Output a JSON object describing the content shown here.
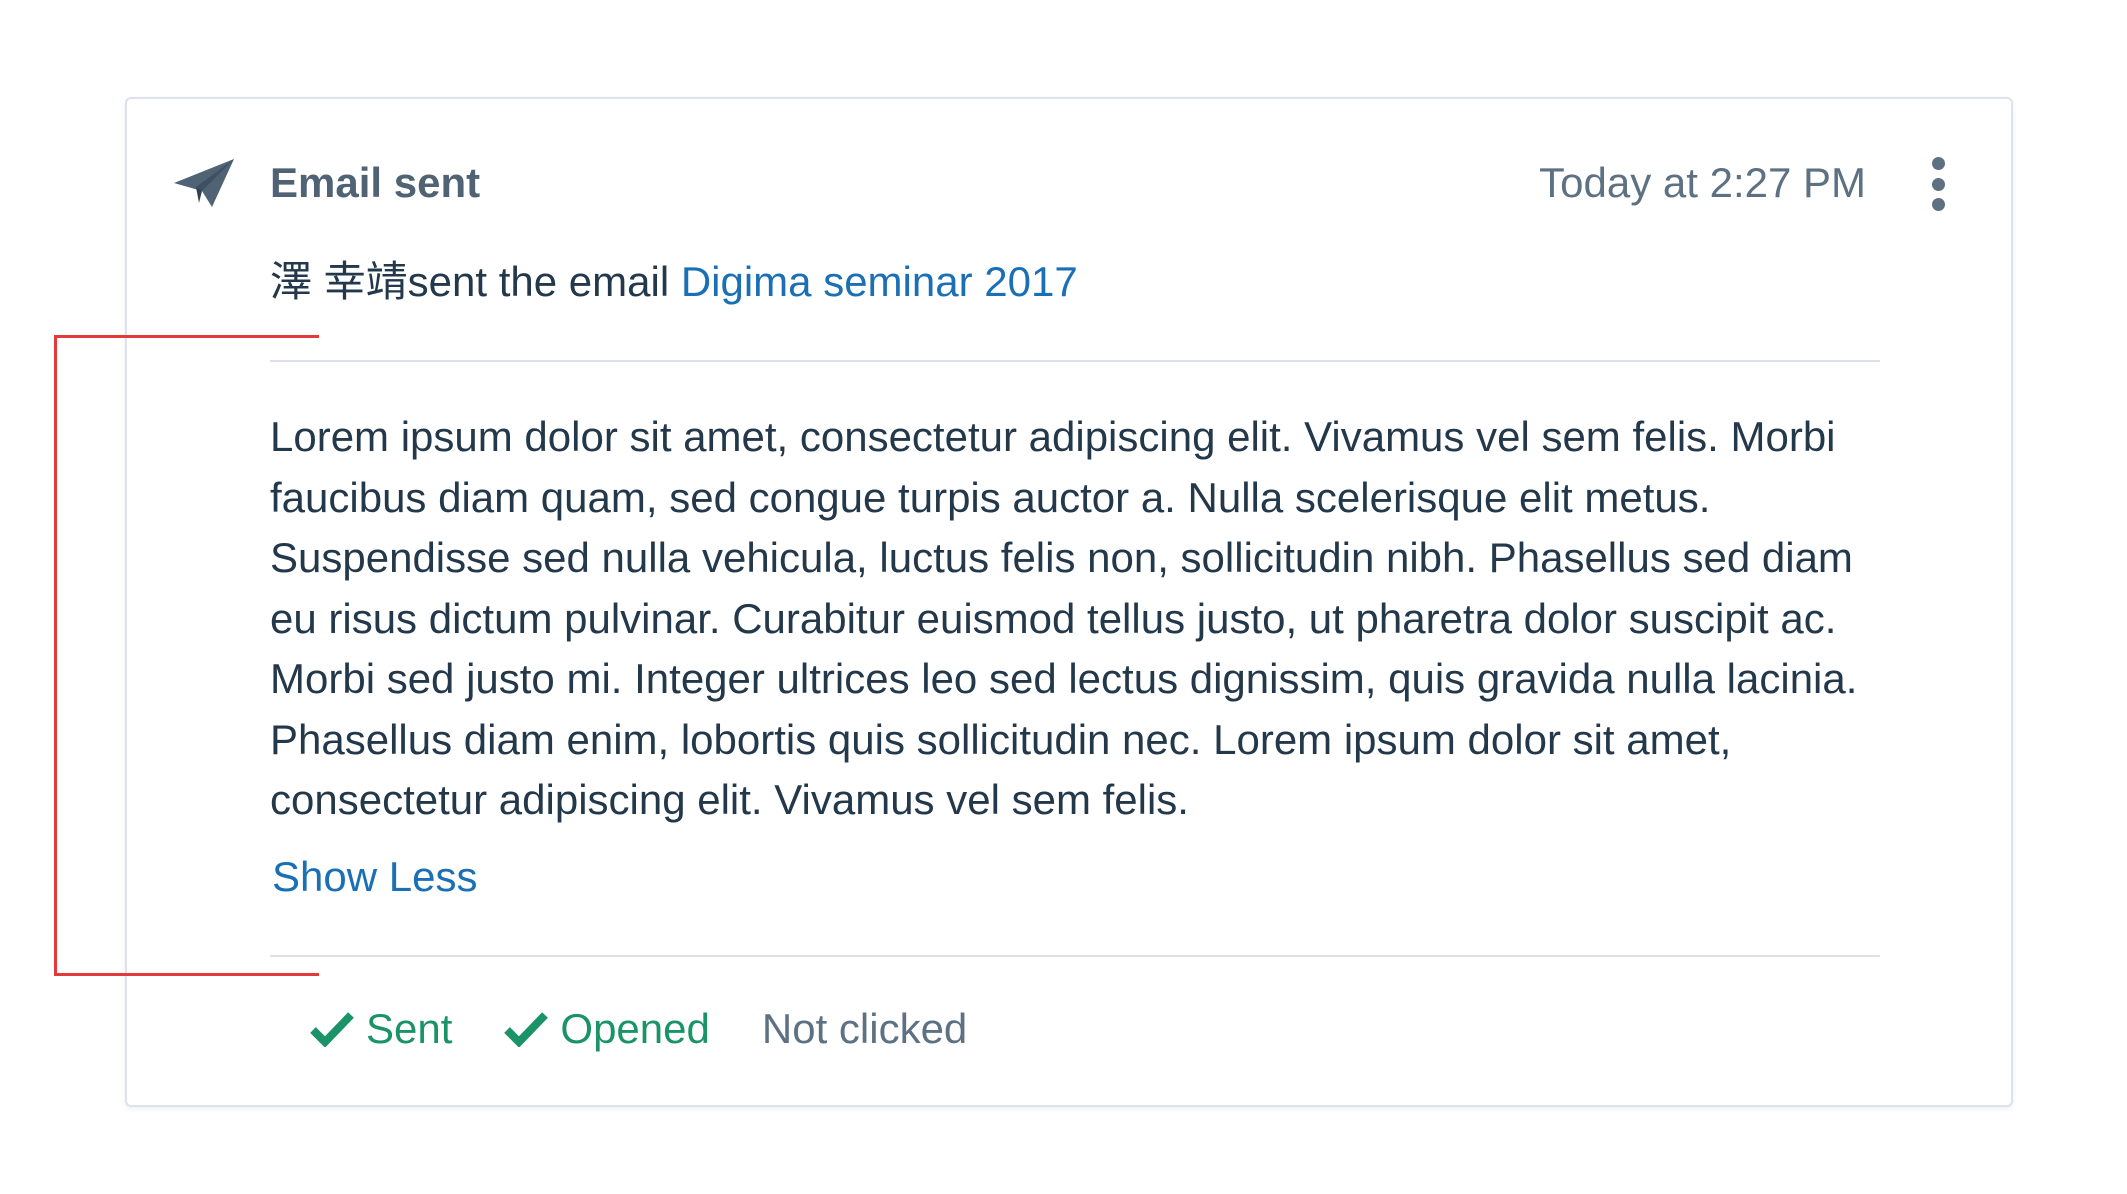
{
  "event": {
    "icon": "paper-plane-icon",
    "title": "Email sent",
    "timestamp": "Today at 2:27 PM",
    "menu_icon": "more-vertical-icon"
  },
  "summary": {
    "actor": "澤 幸靖",
    "action": "sent the email ",
    "email_link": "Digima seminar 2017"
  },
  "body": {
    "text": "Lorem ipsum dolor sit amet, consectetur adipiscing elit. Vivamus vel sem felis. Morbi faucibus diam quam, sed congue turpis auctor a. Nulla scelerisque elit metus. Suspendisse sed nulla vehicula, luctus felis non, sollicitudin nibh. Phasellus sed diam eu risus dictum pulvinar. Curabitur euismod tellus justo, ut pharetra dolor suscipit ac. Morbi sed justo mi. Integer ultrices leo sed lectus dignissim, quis gravida nulla lacinia. Phasellus diam enim, lobortis quis sollicitudin nec. Lorem ipsum dolor sit amet, consectetur adipiscing elit. Vivamus vel sem felis.",
    "toggle_label": "Show Less"
  },
  "statuses": {
    "sent": {
      "label": "Sent",
      "icon": "check-icon",
      "state": "done"
    },
    "opened": {
      "label": "Opened",
      "icon": "check-icon",
      "state": "done"
    },
    "clicked": {
      "label": "Not clicked",
      "state": "pending"
    }
  },
  "colors": {
    "heading": "#4f6374",
    "body_text": "#23384a",
    "link": "#1a6fb5",
    "success": "#1a9466",
    "muted": "#5d7183",
    "annotation": "#e3393b",
    "border": "#dde3ea"
  }
}
